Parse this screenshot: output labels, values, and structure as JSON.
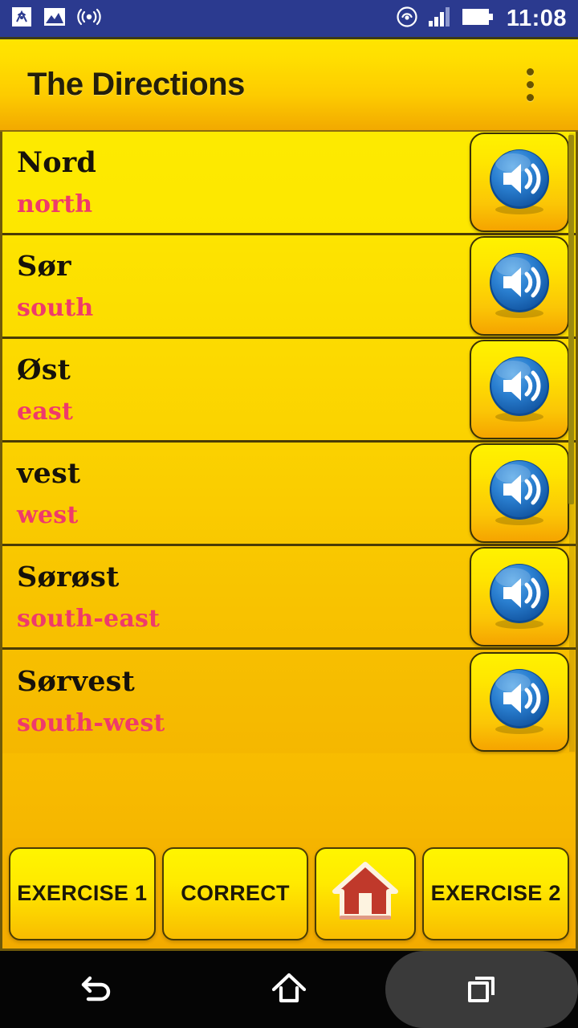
{
  "status_bar": {
    "time": "11:08",
    "left_icons": [
      "hotspot-icon",
      "image-icon",
      "broadcast-icon"
    ],
    "right_icons": [
      "wifi-circle-icon",
      "signal-bars-icon",
      "battery-full-icon"
    ],
    "background_color": "#2b3a8f",
    "icon_color": "#ffffff"
  },
  "appbar": {
    "title": "The Directions",
    "overflow_label": "More options",
    "gradient_from": "#ffe400",
    "gradient_to": "#f2a900",
    "title_color": "#241f0a"
  },
  "list": {
    "native_color": "#17120a",
    "translation_color": "#ef3a6b",
    "rows": [
      {
        "native": "Nord",
        "translation": "north",
        "audio_label": "Play Nord"
      },
      {
        "native": "Sør",
        "translation": "south",
        "audio_label": "Play Sør"
      },
      {
        "native": "Øst",
        "translation": "east",
        "audio_label": "Play Øst"
      },
      {
        "native": "vest",
        "translation": "west",
        "audio_label": "Play vest"
      },
      {
        "native": "Sørøst",
        "translation": "south-east",
        "audio_label": "Play Sørøst"
      },
      {
        "native": "Sørvest",
        "translation": "south-west",
        "audio_label": "Play Sørvest"
      }
    ]
  },
  "buttons": {
    "exercise_1": "EXERCISE 1",
    "correct": "CORRECT",
    "home_icon": "house-icon",
    "exercise_2": "EXERCISE 2",
    "face_color": "#ffea00",
    "label_color": "#1d1808"
  },
  "nav_bar": {
    "back": "back-icon",
    "home": "home-icon",
    "recents": "recents-icon",
    "background_color": "#050505"
  }
}
